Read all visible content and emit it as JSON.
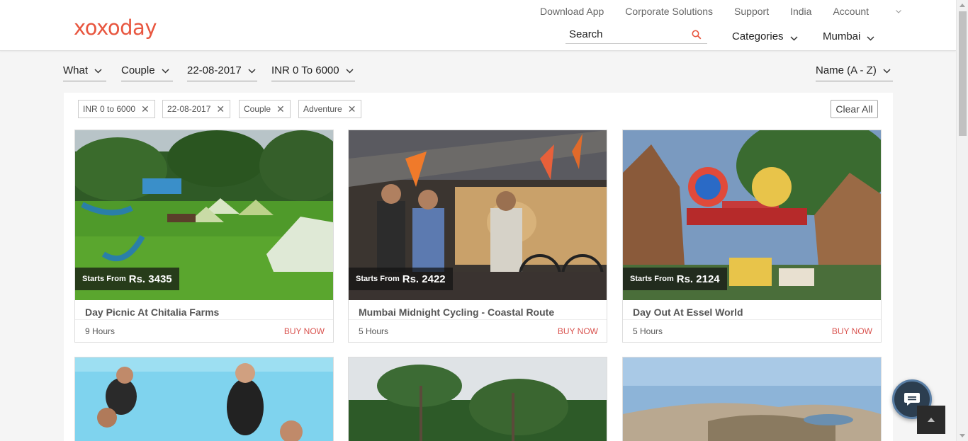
{
  "header": {
    "logo": "xoxoday",
    "top_links": [
      "Download App",
      "Corporate Solutions",
      "Support",
      "India"
    ],
    "account": "Account",
    "search_label": "Search",
    "categories": "Categories",
    "city": "Mumbai"
  },
  "filters": {
    "what": "What",
    "who": "Couple",
    "date": "22-08-2017",
    "budget": "INR 0 To 6000",
    "sort": "Name (A - Z)"
  },
  "chips": [
    "INR 0 to 6000",
    "22-08-2017",
    "Couple",
    "Adventure"
  ],
  "chip_close": "✕",
  "clear_all": "Clear All",
  "cards": [
    {
      "starts_from": "Starts From",
      "price": "Rs. 3435",
      "title": "Day Picnic At Chitalia Farms",
      "duration": "9 Hours",
      "buy": "BUY NOW"
    },
    {
      "starts_from": "Starts From",
      "price": "Rs. 2422",
      "title": "Mumbai Midnight Cycling - Coastal Route",
      "duration": "5 Hours",
      "buy": "BUY NOW"
    },
    {
      "starts_from": "Starts From",
      "price": "Rs. 2124",
      "title": "Day Out At Essel World",
      "duration": "5 Hours",
      "buy": "BUY NOW"
    }
  ],
  "colors": {
    "brand": "#e8563f",
    "buy_now": "#d9534f",
    "chat": "#2c3e50"
  }
}
